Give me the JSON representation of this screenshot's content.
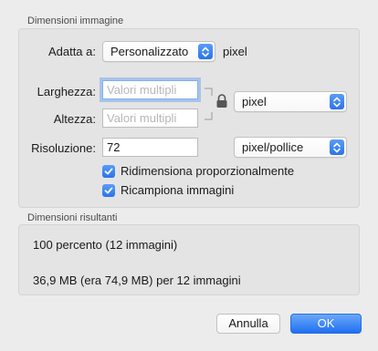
{
  "image_dimensions": {
    "title": "Dimensioni immagine",
    "fit_label": "Adatta a:",
    "fit_value": "Personalizzato",
    "fit_unit": "pixel",
    "width_label": "Larghezza:",
    "width_placeholder": "Valori multipli",
    "height_label": "Altezza:",
    "height_placeholder": "Valori multipli",
    "size_unit": "pixel",
    "resolution_label": "Risoluzione:",
    "resolution_value": "72",
    "resolution_unit": "pixel/pollice",
    "scale_proportionally": {
      "label": "Ridimensiona proporzionalmente",
      "checked": true
    },
    "resample": {
      "label": "Ricampiona immagini",
      "checked": true
    }
  },
  "resulting": {
    "title": "Dimensioni risultanti",
    "percent_text": "100 percento (12 immagini)",
    "size_text": "36,9 MB (era 74,9 MB) per 12 immagini"
  },
  "buttons": {
    "cancel": "Annulla",
    "ok": "OK"
  },
  "colors": {
    "accent": "#2a73ea",
    "window_bg": "#ececec",
    "group_bg": "#e4e4e4"
  }
}
